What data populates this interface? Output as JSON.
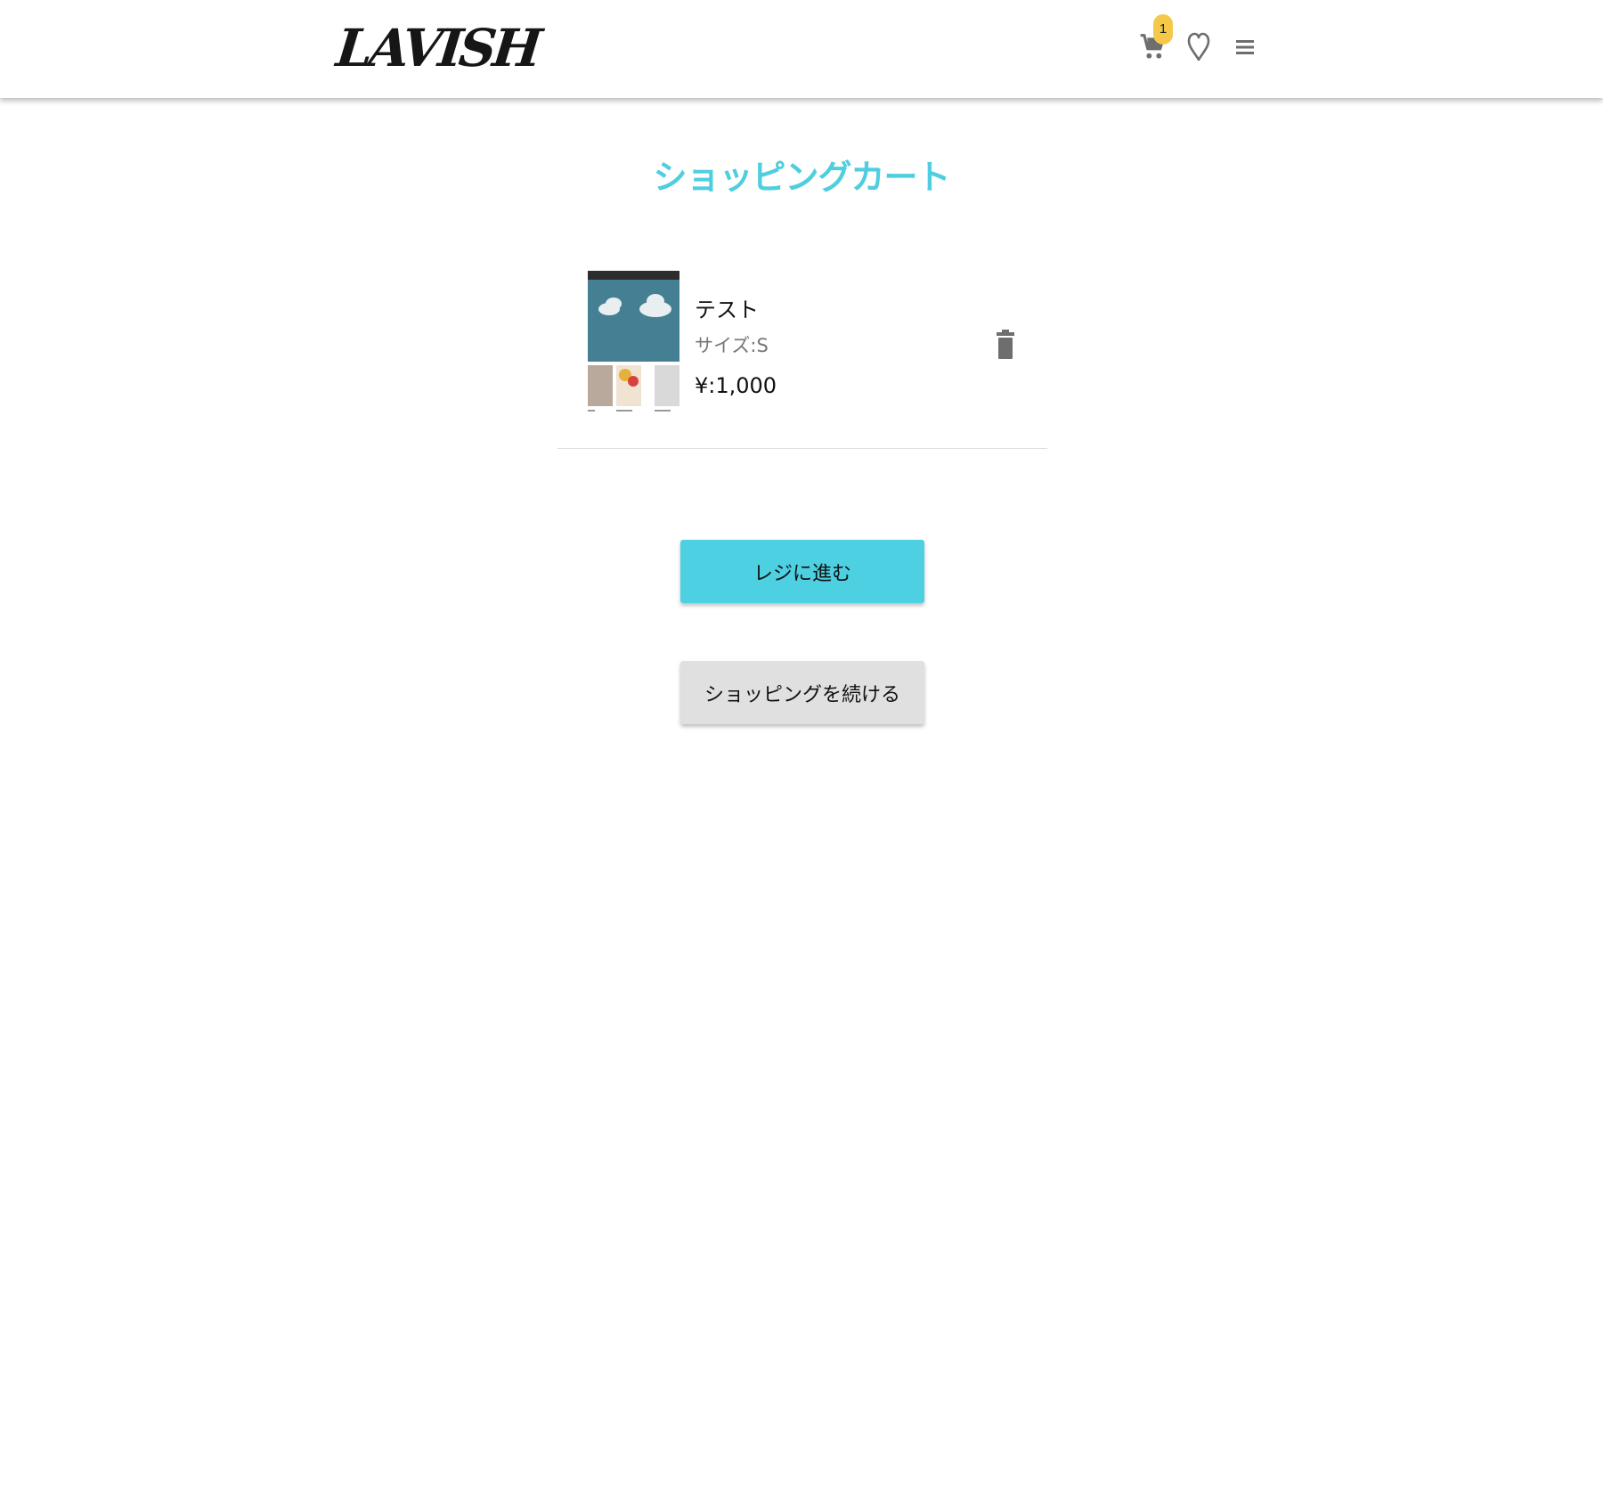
{
  "header": {
    "logo_text": "LAVISH",
    "cart_count": "1",
    "icons": {
      "cart": "cart-icon",
      "favorite": "heart-icon",
      "menu": "menu-icon"
    }
  },
  "page": {
    "title": "ショッピングカート"
  },
  "cart": {
    "items": [
      {
        "name": "テスト",
        "size": "サイズ:S",
        "price": "¥:1,000",
        "delete_icon": "trash-icon"
      }
    ]
  },
  "actions": {
    "checkout_label": "レジに進む",
    "continue_label": "ショッピングを続ける"
  },
  "colors": {
    "accent": "#4dd0e1",
    "title": "#4fcedf",
    "badge": "#f5c84a",
    "secondary_button": "#e0e0e0"
  }
}
